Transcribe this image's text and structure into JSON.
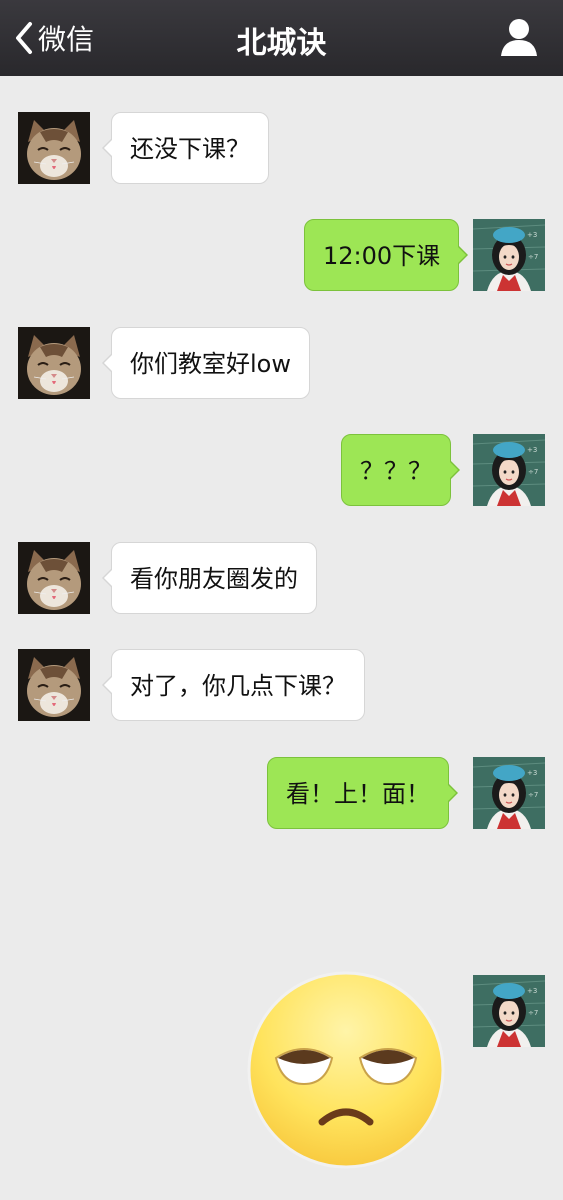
{
  "navbar": {
    "back_label": "微信",
    "title": "北城诀"
  },
  "messages": [
    {
      "side": "in",
      "text": "还没下课？"
    },
    {
      "side": "out",
      "text": "12:00下课"
    },
    {
      "side": "in",
      "text": "你们教室好low"
    },
    {
      "side": "out",
      "text": "？？？"
    },
    {
      "side": "in",
      "text": "看你朋友圈发的"
    },
    {
      "side": "in",
      "text": "对了，你几点下课？"
    },
    {
      "side": "out",
      "text": "看！上！面！"
    },
    {
      "side": "out",
      "sticker": "rolling-eyes-emoji"
    }
  ],
  "colors": {
    "navbar": "#2f2e33",
    "background": "#ebebeb",
    "outgoing_bubble": "#9de655",
    "incoming_bubble": "#ffffff"
  },
  "icons": {
    "back": "chevron-left-icon",
    "profile": "person-icon"
  }
}
